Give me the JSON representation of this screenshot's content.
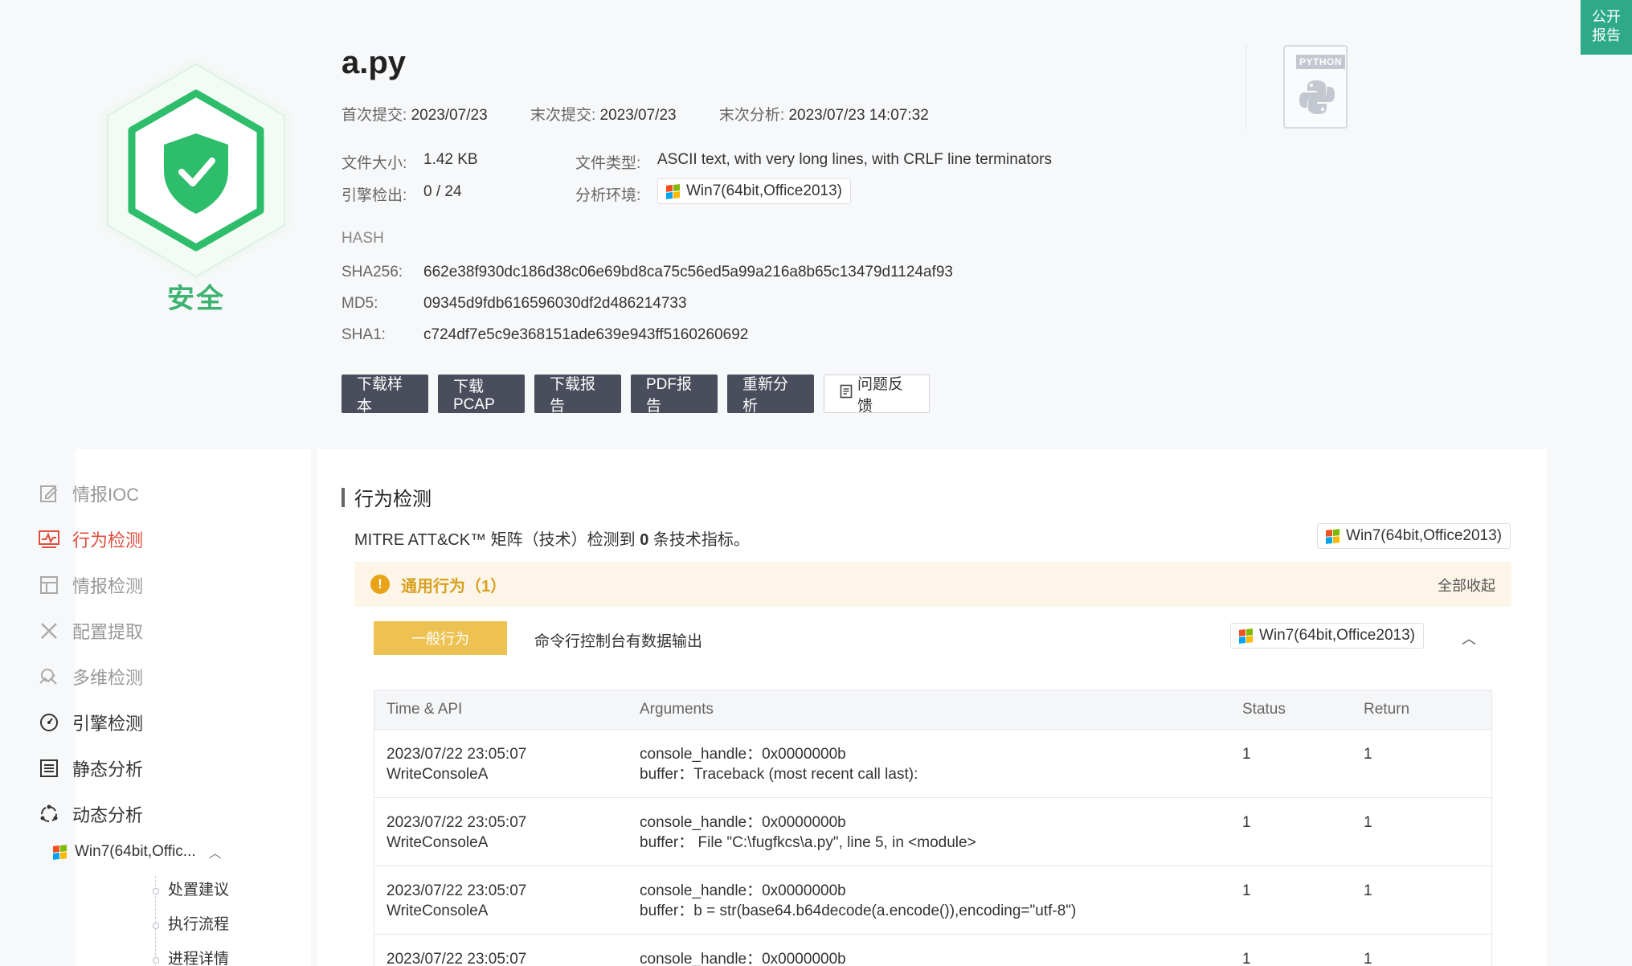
{
  "file": {
    "name": "a.py",
    "verdict": "安全",
    "first_submit_label": "首次提交:",
    "first_submit": "2023/07/23",
    "last_submit_label": "末次提交:",
    "last_submit": "2023/07/23",
    "last_analysis_label": "末次分析:",
    "last_analysis": "2023/07/23 14:07:32",
    "size_label": "文件大小:",
    "size": "1.42 KB",
    "type_label": "文件类型:",
    "type": "ASCII text, with very long lines, with CRLF line terminators",
    "engine_label": "引擎检出:",
    "engine": "0 / 24",
    "env_label": "分析环境:",
    "env": "Win7(64bit,Office2013)",
    "file_type_icon_label": "PYTHON"
  },
  "hash": {
    "title": "HASH",
    "sha256_label": "SHA256:",
    "sha256": "662e38f930dc186d38c06e69bd8ca75c56ed5a99a216a8b65c13479d1124af93",
    "md5_label": "MD5:",
    "md5": "09345d9fdb616596030df2d486214733",
    "sha1_label": "SHA1:",
    "sha1": "c724df7e5c9e368151ade639e943ff5160260692"
  },
  "buttons": {
    "download_sample": "下载样本",
    "download_pcap": "下载PCAP",
    "download_report": "下载报告",
    "pdf_report": "PDF报告",
    "reanalyze": "重新分析",
    "feedback": "问题反馈"
  },
  "public_report": {
    "line1": "公开",
    "line2": "报告"
  },
  "sidebar": {
    "items": [
      {
        "label": "情报IOC"
      },
      {
        "label": "行为检测"
      },
      {
        "label": "情报检测"
      },
      {
        "label": "配置提取"
      },
      {
        "label": "多维检测"
      },
      {
        "label": "引擎检测"
      },
      {
        "label": "静态分析"
      },
      {
        "label": "动态分析"
      }
    ],
    "env_label": "Win7(64bit,Offic...",
    "sub_items": [
      "处置建议",
      "执行流程",
      "进程详情"
    ]
  },
  "main": {
    "section_title": "行为检测",
    "mitre_prefix": "MITRE ATT&CK™ 矩阵（技术）检测到 ",
    "mitre_count": "0",
    "mitre_suffix": " 条技术指标。",
    "env": "Win7(64bit,Office2013)",
    "general_title": "通用行为（1）",
    "collapse_all": "全部收起",
    "behavior_tag": "一般行为",
    "behavior_text": "命令行控制台有数据输出",
    "behavior_env": "Win7(64bit,Office2013)",
    "table": {
      "headers": [
        "Time & API",
        "Arguments",
        "Status",
        "Return"
      ],
      "rows": [
        {
          "time": "2023/07/22 23:05:07",
          "api": "WriteConsoleA",
          "arg1": "console_handle：0x0000000b",
          "arg2": "buffer：Traceback (most recent call last):",
          "status": "1",
          "ret": "1"
        },
        {
          "time": "2023/07/22 23:05:07",
          "api": "WriteConsoleA",
          "arg1": "console_handle：0x0000000b",
          "arg2": "buffer：  File \"C:\\fugfkcs\\a.py\", line 5, in <module>",
          "status": "1",
          "ret": "1"
        },
        {
          "time": "2023/07/22 23:05:07",
          "api": "WriteConsoleA",
          "arg1": "console_handle：0x0000000b",
          "arg2": "buffer：b = str(base64.b64decode(a.encode()),encoding=\"utf-8\")",
          "status": "1",
          "ret": "1"
        },
        {
          "time": "2023/07/22 23:05:07",
          "api": "",
          "arg1": "console_handle：0x0000000b",
          "arg2": "",
          "status": "1",
          "ret": "1"
        }
      ]
    }
  },
  "colors": {
    "safe_green": "#3cb371",
    "active_red": "#e04d3c",
    "warning_yellow": "#edc252",
    "dark_button": "#4a4e5c"
  }
}
